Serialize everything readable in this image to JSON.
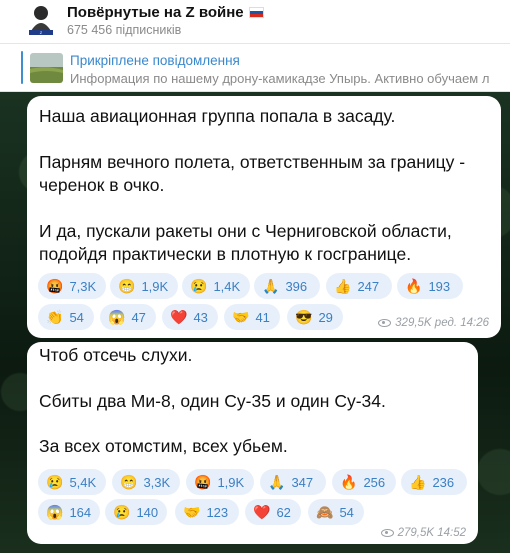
{
  "header": {
    "title": "Повёрнутые на Z войне",
    "subscribers": "675 456 підписників",
    "flag_colors": [
      "#ffffff",
      "#1c57a5",
      "#d52b1e"
    ],
    "avatar_icon": "channel-avatar-icon"
  },
  "pinned": {
    "title": "Прикріплене повідомлення",
    "text": "Информация по нашему дрону-камикадзе Упырь.  Активно обучаем л",
    "accent": "#3e8ed0"
  },
  "messages": [
    {
      "lines": [
        "Наша авиационная группа попала в засаду.",
        "",
        "Парням вечного полета, ответственным за границу -",
        "черенок в очко.",
        "",
        "И да, пускали ракеты они с Черниговской области,",
        "подойдя практически в плотную к госгранице."
      ],
      "reactions_row1": [
        {
          "emoji": "🤬",
          "count": "7,3K"
        },
        {
          "emoji": "😁",
          "count": "1,9K"
        },
        {
          "emoji": "😢",
          "count": "1,4K"
        },
        {
          "emoji": "🙏",
          "count": "396"
        },
        {
          "emoji": "👍",
          "count": "247"
        },
        {
          "emoji": "🔥",
          "count": "193"
        }
      ],
      "reactions_row2": [
        {
          "emoji": "👏",
          "count": "54"
        },
        {
          "emoji": "😱",
          "count": "47"
        },
        {
          "emoji": "❤️",
          "count": "43"
        },
        {
          "emoji": "🤝",
          "count": "41"
        },
        {
          "emoji": "😎",
          "count": "29"
        }
      ],
      "meta": "329,5K ред. 14:26"
    },
    {
      "lines": [
        "Чтоб отсечь слухи.",
        "",
        "Сбиты два Ми-8, один Су-35 и один Су-34.",
        "",
        "За всех отомстим, всех убьем."
      ],
      "reactions_row1": [
        {
          "emoji": "😢",
          "count": "5,4K"
        },
        {
          "emoji": "😁",
          "count": "3,3K"
        },
        {
          "emoji": "🤬",
          "count": "1,9K"
        },
        {
          "emoji": "🙏",
          "count": "347"
        },
        {
          "emoji": "🔥",
          "count": "256"
        },
        {
          "emoji": "👍",
          "count": "236"
        }
      ],
      "reactions_row2": [
        {
          "emoji": "😱",
          "count": "164"
        },
        {
          "emoji": "😢",
          "count": "140"
        },
        {
          "emoji": "🤝",
          "count": "123"
        },
        {
          "emoji": "❤️",
          "count": "62"
        },
        {
          "emoji": "🙈",
          "count": "54"
        }
      ],
      "meta": "279,5K 14:52"
    }
  ]
}
